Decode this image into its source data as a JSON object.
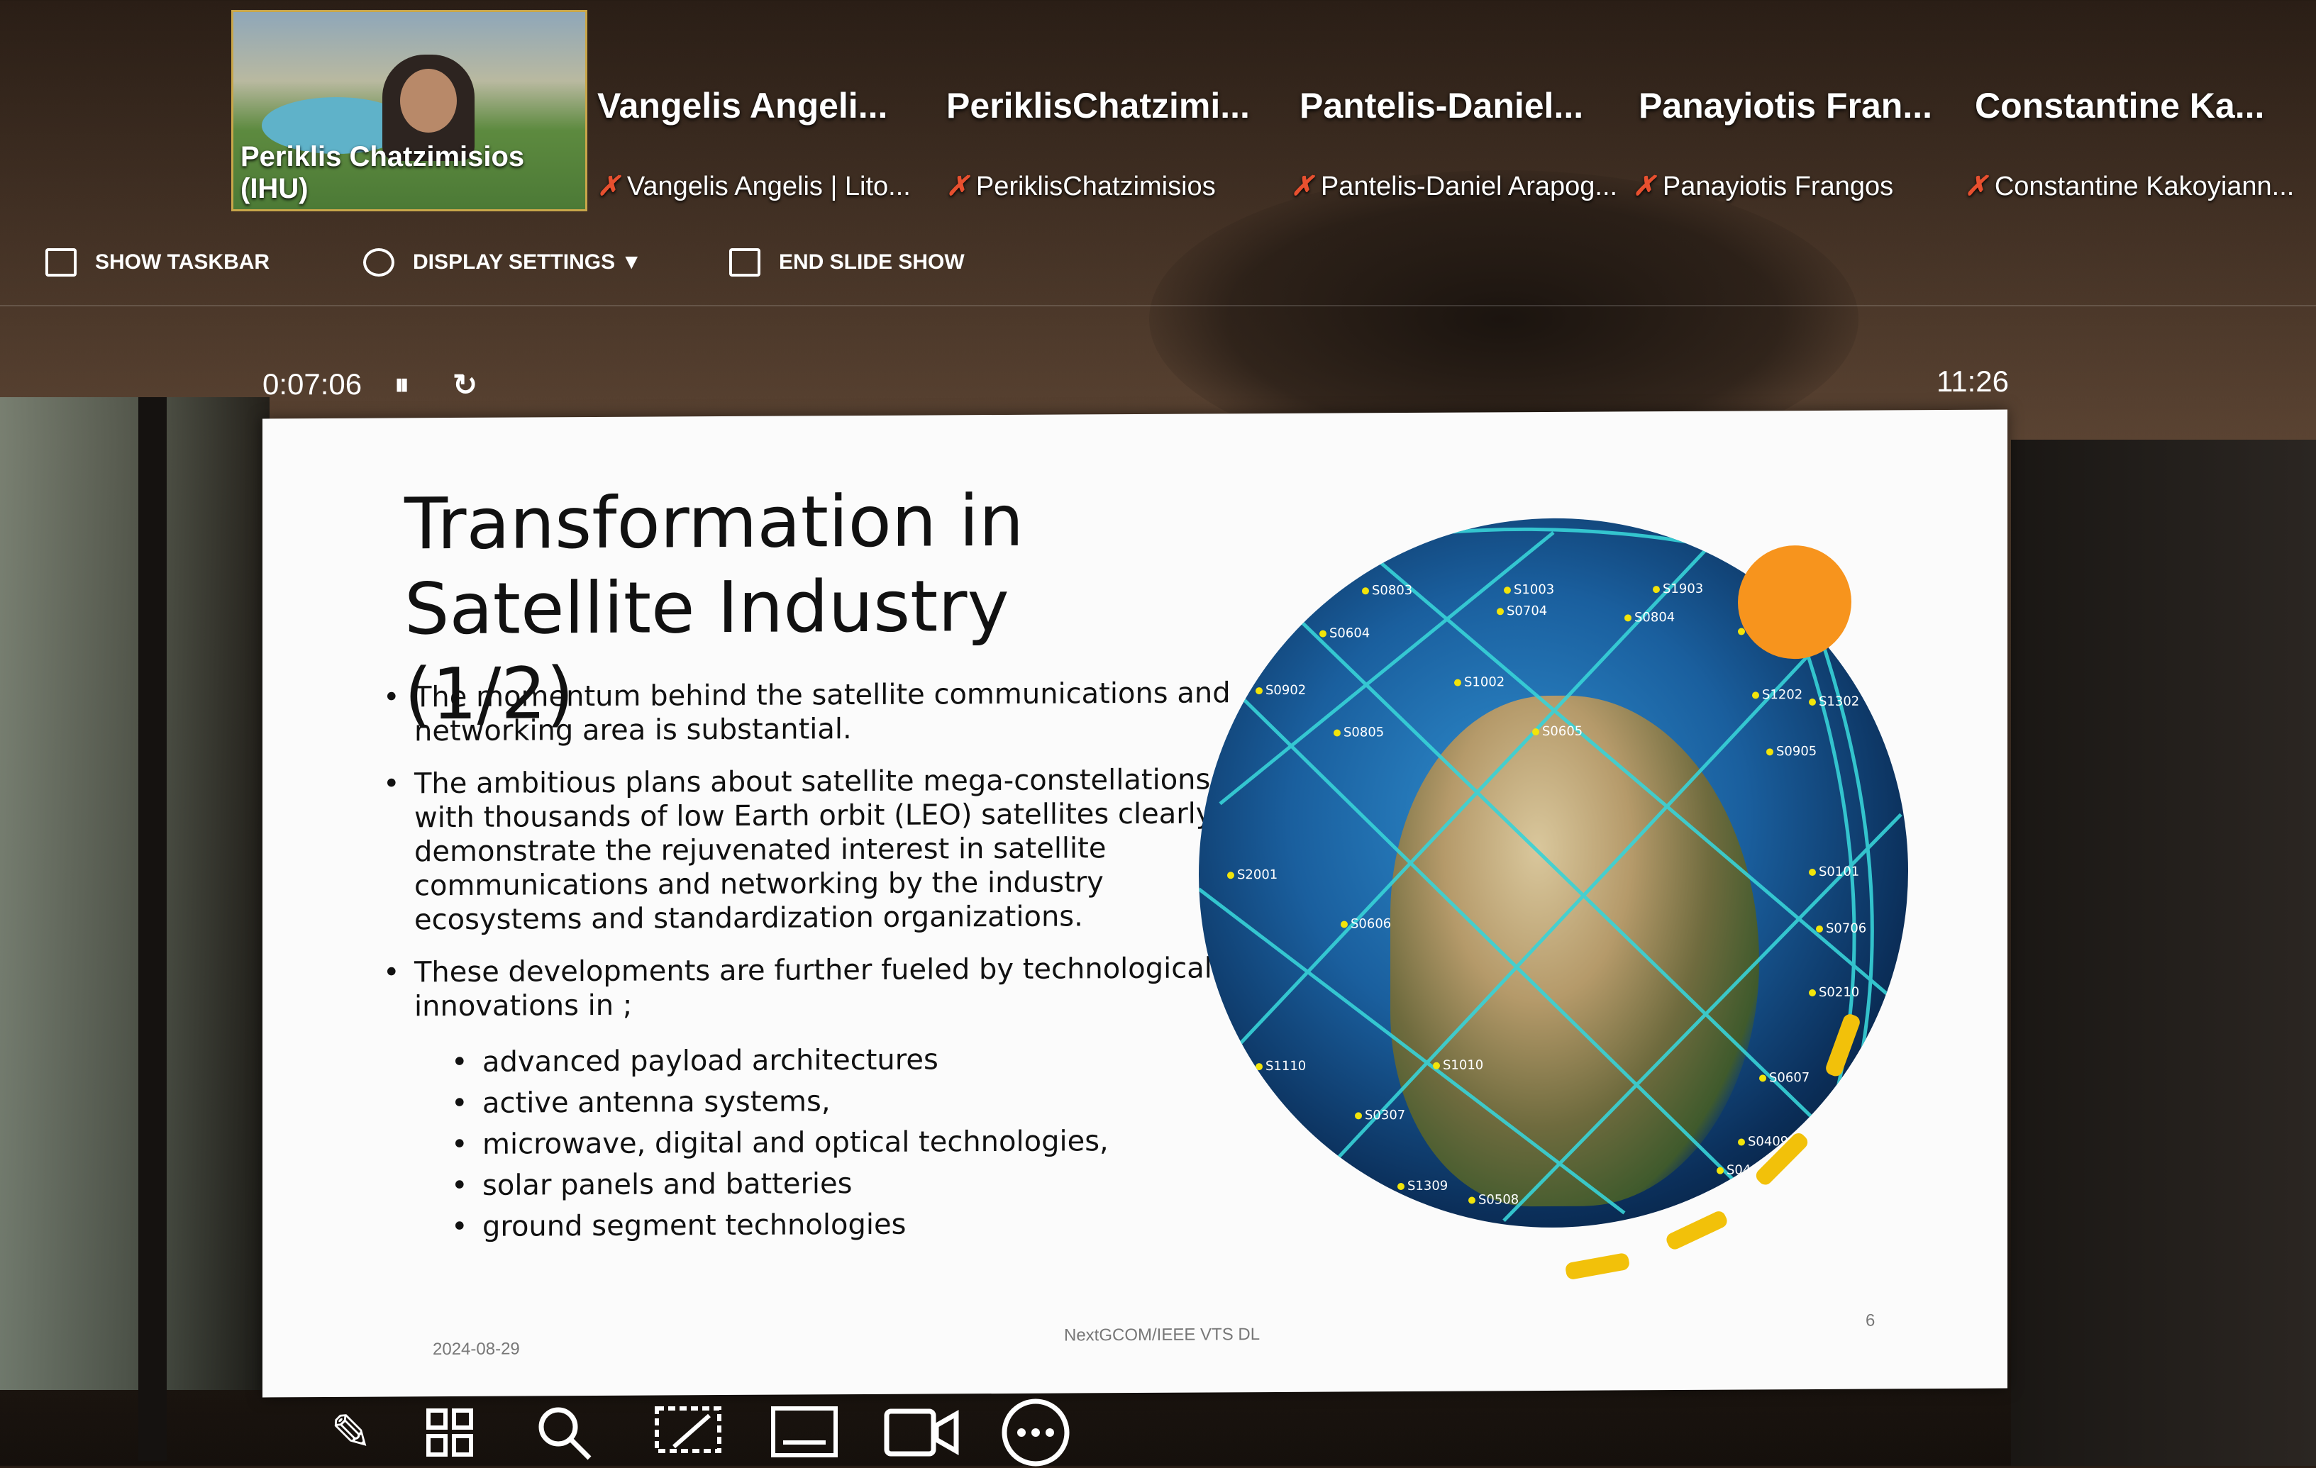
{
  "participants": {
    "self": {
      "name": "Periklis Chatzimisios (IHU)"
    },
    "tiles": [
      {
        "name": "Vangelis  Angeli...",
        "sub": "Vangelis Angelis | Lito..."
      },
      {
        "name": "PeriklisChatzimi...",
        "sub": "PeriklisChatzimisios"
      },
      {
        "name": "Pantelis-Daniel...",
        "sub": "Pantelis-Daniel Arapog..."
      },
      {
        "name": "Panayiotis  Fran...",
        "sub": "Panayiotis Frangos"
      },
      {
        "name": "Constantine  Ka...",
        "sub": "Constantine Kakoyiann..."
      }
    ]
  },
  "toolbar": {
    "show_taskbar": "SHOW TASKBAR",
    "display_settings": "DISPLAY SETTINGS ▼",
    "end_slide_show": "END SLIDE SHOW"
  },
  "presenter": {
    "elapsed": "0:07:06",
    "pause_icon": "⏸",
    "reset_icon": "↻",
    "clock": "11:26"
  },
  "slide": {
    "title_line1": "Transformation in",
    "title_line2": "Satellite Industry (1/2)",
    "bullets": [
      "The momentum behind the satellite communications and networking area is substantial.",
      "The ambitious plans about satellite mega-constellations with thousands of low Earth orbit (LEO) satellites clearly demonstrate the rejuvenated interest in satellite communications and networking by the industry ecosystems and standardization organizations.",
      "These developments are further fueled by technological innovations in ;"
    ],
    "sub_bullets": [
      "advanced payload architectures",
      "active antenna systems,",
      "microwave, digital and optical technologies,",
      "solar panels and batteries",
      "ground segment technologies"
    ],
    "date": "2024-08-29",
    "footer_center": "NextGCOM/IEEE VTS DL",
    "page_number": "6",
    "satellite_labels": [
      "S0803",
      "S1003",
      "S1903",
      "S0604",
      "S0704",
      "S0804",
      "S1004",
      "S0902",
      "S1002",
      "S1202",
      "S1302",
      "S0805",
      "S0605",
      "S0905",
      "S2001",
      "S0101",
      "S0606",
      "S0706",
      "S1110",
      "S1010",
      "S0210",
      "S0307",
      "S0607",
      "S1309",
      "S0409",
      "S0508",
      "S0408"
    ]
  },
  "bottom_bar": {
    "icons": [
      "pen-icon",
      "slides-grid-icon",
      "zoom-icon",
      "laser-pointer-icon",
      "subtitles-icon",
      "camera-icon",
      "more-options-icon"
    ]
  },
  "colors": {
    "orbit": "#38d3d8",
    "sun": "#f7941d",
    "arc": "#f2c10a",
    "mic_muted": "#e8502f"
  }
}
